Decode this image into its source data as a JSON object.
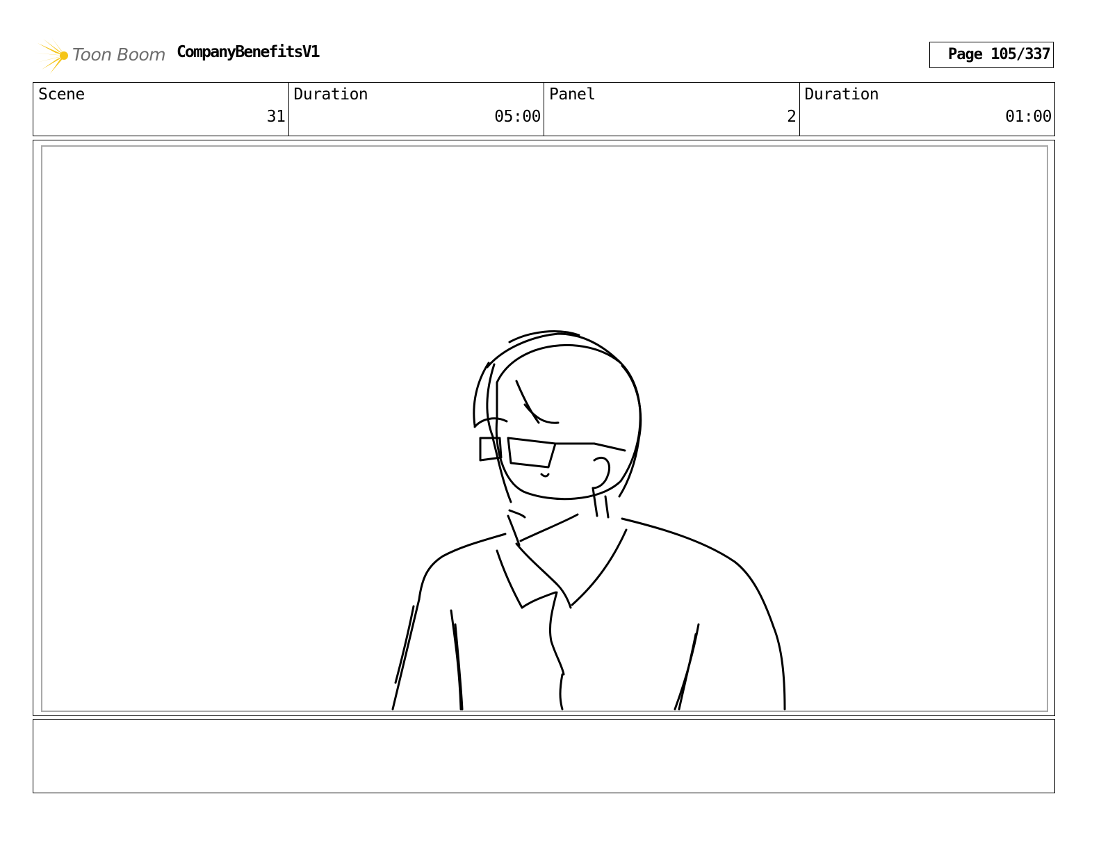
{
  "header": {
    "logo_text": "Toon Boom",
    "project_title": "CompanyBenefitsV1",
    "page_label": "Page 105/337"
  },
  "info": [
    {
      "label": "Scene",
      "value": "31"
    },
    {
      "label": "Duration",
      "value": "05:00"
    },
    {
      "label": "Panel",
      "value": "2"
    },
    {
      "label": "Duration",
      "value": "01:00"
    }
  ],
  "colors": {
    "logo_burst": "#f5c518",
    "logo_text": "#6d6d6d",
    "frame_border": "#000000",
    "panel_inner_border": "#a9a9a9"
  },
  "notes": ""
}
